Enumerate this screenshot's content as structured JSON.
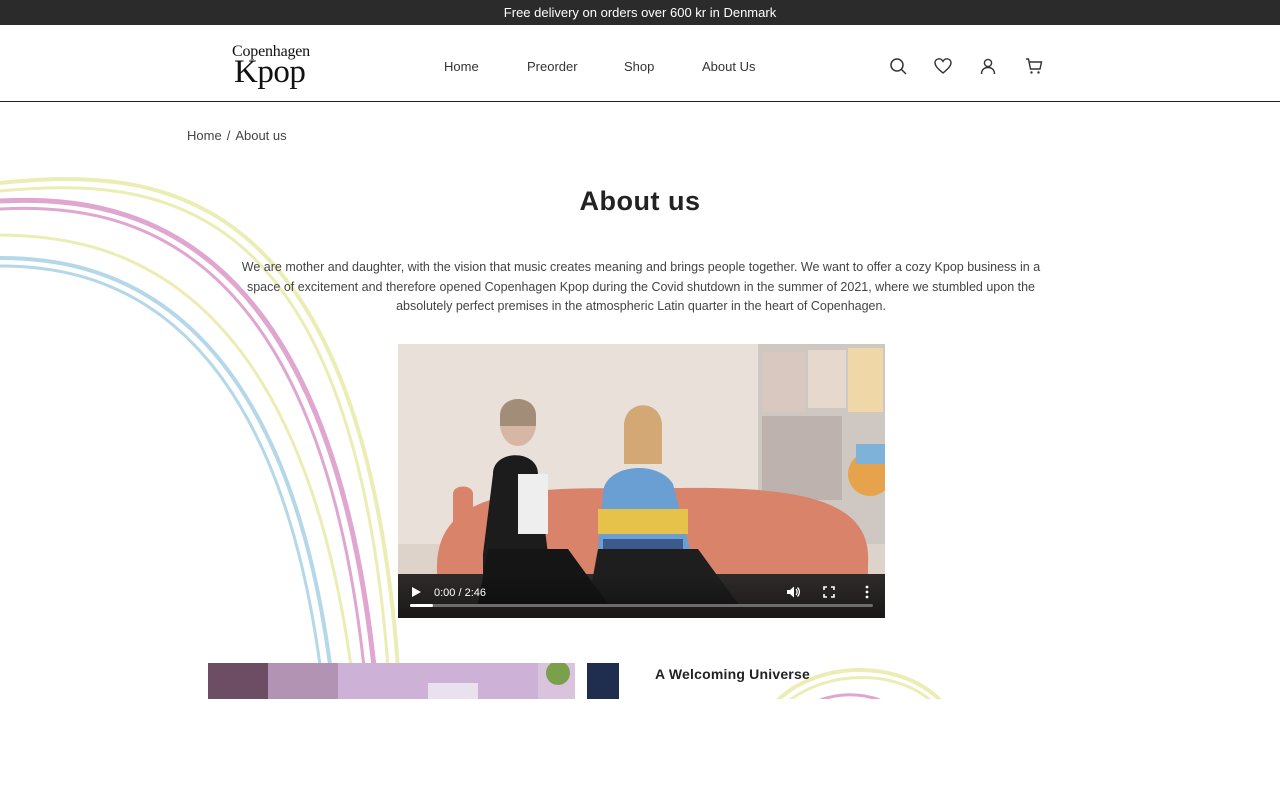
{
  "announcement": "Free delivery on orders over 600 kr in Denmark",
  "logo": {
    "line1": "Copenhagen",
    "line2": "Kpop"
  },
  "nav": {
    "items": [
      {
        "label": "Home"
      },
      {
        "label": "Preorder"
      },
      {
        "label": "Shop"
      },
      {
        "label": "About Us"
      }
    ]
  },
  "header_icons": [
    "search-icon",
    "heart-icon",
    "account-icon",
    "cart-icon"
  ],
  "breadcrumb": {
    "home": "Home",
    "separator": "/",
    "current": "About us"
  },
  "page": {
    "title": "About us",
    "intro": "We are mother and daughter, with the vision that music creates meaning and brings people together. We want to offer a cozy Kpop business in a space of excitement and therefore opened Copenhagen Kpop during the Covid shutdown in the summer of 2021, where we stumbled upon the absolutely perfect premises in the atmospheric Latin quarter in the heart of Copenhagen."
  },
  "video": {
    "time": "0:00 / 2:46",
    "progress": 0.05
  },
  "section": {
    "heading": "A Welcoming Universe"
  },
  "colors": {
    "announce_bg": "#2b2b2b",
    "pink": "#e0a6d0",
    "yellow": "#ecedb4",
    "blue": "#b4d8e8"
  }
}
